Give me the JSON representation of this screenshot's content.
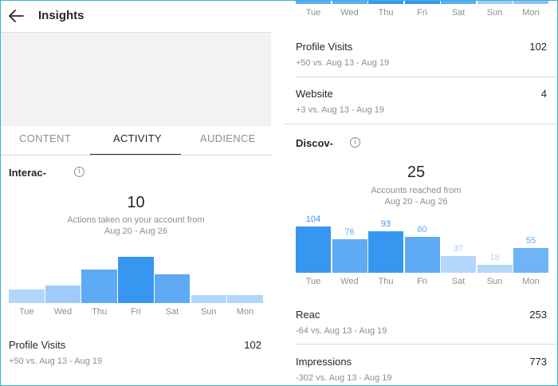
{
  "header": {
    "title": "Insights"
  },
  "tabs": [
    {
      "label": "CONTENT"
    },
    {
      "label": "ACTIVITY"
    },
    {
      "label": "AUDIENCE"
    }
  ],
  "interactions": {
    "title": "Interac-",
    "total": "10",
    "caption_line1": "Actions taken on your account from",
    "caption_line2": "Aug 20 - Aug 26",
    "chart": {
      "days": [
        "Tue",
        "Wed",
        "Thu",
        "Fri",
        "Sat",
        "Sun",
        "Mon"
      ],
      "levels": [
        0.3,
        0.38,
        0.72,
        1.0,
        0.62,
        0.17,
        0.17
      ],
      "colors": [
        "#b3d6fb",
        "#a0cbf9",
        "#5eaaf5",
        "#3797f0",
        "#5eaaf5",
        "#b3d6fb",
        "#b3d6fb"
      ]
    },
    "profile_visits": {
      "label": "Profile Visits",
      "value": "102",
      "sub": "+50 vs. Aug 13 - Aug 19"
    }
  },
  "right_top": {
    "days": [
      "Tue",
      "Wed",
      "Thu",
      "Fri",
      "Sat",
      "Sun",
      "Mon"
    ],
    "colors": [
      "#5eaaf5",
      "#5eaaf5",
      "#3797f0",
      "#3797f0",
      "#5eaaf5",
      "#a0cbf9",
      "#8fc2f8"
    ],
    "profile_visits": {
      "label": "Profile Visits",
      "value": "102",
      "sub": "+50 vs. Aug 13 - Aug 19"
    },
    "website": {
      "label": "Website",
      "value": "4",
      "sub": "+3 vs. Aug 13 - Aug 19"
    }
  },
  "discovery": {
    "title": "Discov-",
    "total": "25",
    "caption_line1": "Accounts reached from",
    "caption_line2": "Aug 20 - Aug 26",
    "chart": {
      "days": [
        "Tue",
        "Wed",
        "Thu",
        "Fri",
        "Sat",
        "Sun",
        "Mon"
      ],
      "values": [
        104,
        76,
        93,
        80,
        37,
        18,
        55
      ],
      "labels": [
        "104",
        "76",
        "93",
        "80",
        "37",
        "18",
        "55"
      ],
      "colors": [
        "#3797f0",
        "#5eaaf5",
        "#3797f0",
        "#5eaaf5",
        "#b3d6fb",
        "#b3d6fb",
        "#6fb4f6"
      ],
      "label_colors": [
        "#3797f0",
        "#5eaaf5",
        "#3797f0",
        "#5eaaf5",
        "#a0cbf9",
        "#b3d6fb",
        "#5eaaf5"
      ]
    },
    "reach": {
      "label": "Reac",
      "value": "253",
      "sub": "-64 vs. Aug 13 - Aug 19"
    },
    "impressions": {
      "label": "Impressions",
      "value": "773",
      "sub": "-302 vs. Aug 13 - Aug 19"
    }
  }
}
